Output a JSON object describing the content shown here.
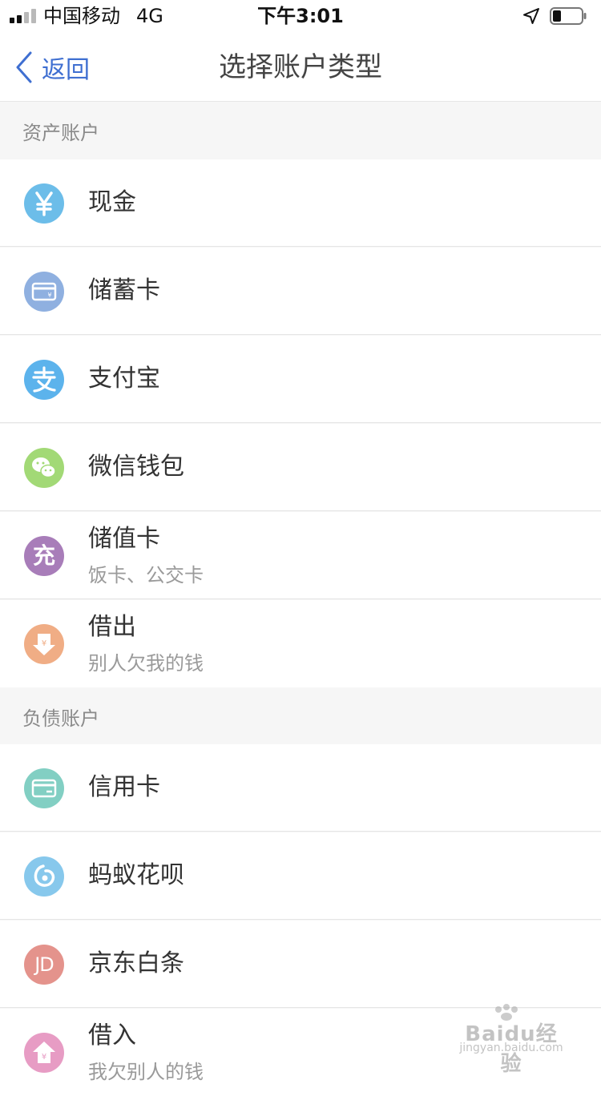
{
  "status_bar": {
    "carrier": "中国移动",
    "network": "4G",
    "time": "下午3:01",
    "battery_level": 0.3
  },
  "nav": {
    "back_label": "返回",
    "title": "选择账户类型"
  },
  "sections": [
    {
      "header": "资产账户",
      "items": [
        {
          "label": "现金",
          "icon": "yuan-icon",
          "color": "#6cbde9"
        },
        {
          "label": "储蓄卡",
          "icon": "debit-card-icon",
          "color": "#8fb0e0"
        },
        {
          "label": "支付宝",
          "icon": "alipay-icon",
          "color": "#5cb3ec"
        },
        {
          "label": "微信钱包",
          "icon": "wechat-icon",
          "color": "#a2d976"
        },
        {
          "label": "储值卡",
          "sub": "饭卡、公交卡",
          "icon": "recharge-icon",
          "icon_text": "充",
          "color": "#a87db9"
        },
        {
          "label": "借出",
          "sub": "别人欠我的钱",
          "icon": "lend-out-icon",
          "color": "#f0ad85"
        }
      ]
    },
    {
      "header": "负债账户",
      "items": [
        {
          "label": "信用卡",
          "icon": "credit-card-icon",
          "color": "#82cfc3"
        },
        {
          "label": "蚂蚁花呗",
          "icon": "huabei-icon",
          "color": "#87c8ec"
        },
        {
          "label": "京东白条",
          "icon": "jd-icon",
          "icon_text": "JD",
          "color": "#e4938c"
        },
        {
          "label": "借入",
          "sub": "我欠别人的钱",
          "icon": "borrow-in-icon",
          "color": "#e79cc4"
        }
      ]
    }
  ],
  "watermark": {
    "brand": "Baidu经验",
    "url": "jingyan.baidu.com"
  }
}
